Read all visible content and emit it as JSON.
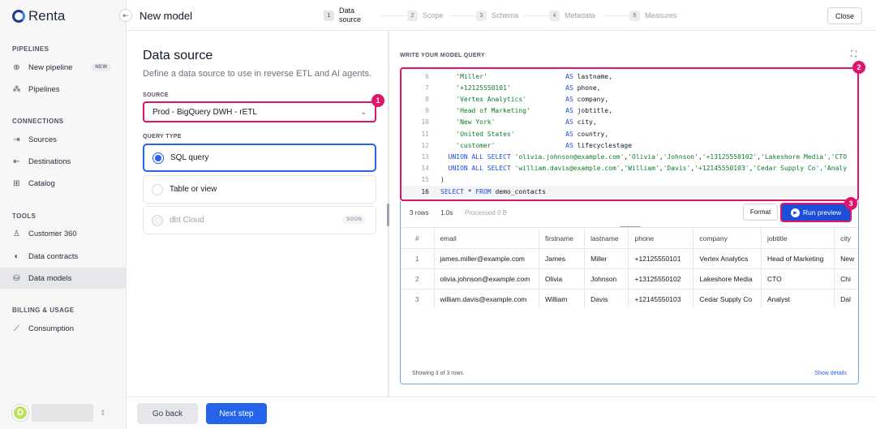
{
  "app": {
    "logo_text": "Renta"
  },
  "sidebar": {
    "sections": [
      {
        "label": "PIPELINES"
      },
      {
        "label": "CONNECTIONS"
      },
      {
        "label": "TOOLS"
      },
      {
        "label": "BILLING & USAGE"
      }
    ],
    "items": [
      {
        "label": "New pipeline",
        "badge": "NEW",
        "icon": "plus-circle-icon"
      },
      {
        "label": "Pipelines",
        "icon": "pipelines-icon"
      },
      {
        "label": "Sources",
        "icon": "sources-icon"
      },
      {
        "label": "Destinations",
        "icon": "destinations-icon"
      },
      {
        "label": "Catalog",
        "icon": "catalog-icon"
      },
      {
        "label": "Customer 360",
        "icon": "user-icon"
      },
      {
        "label": "Data contracts",
        "icon": "shield-icon"
      },
      {
        "label": "Data models",
        "icon": "database-icon",
        "active": true
      },
      {
        "label": "Consumption",
        "icon": "chart-icon"
      }
    ],
    "user": {
      "avatar_letter": "D"
    }
  },
  "header": {
    "title": "New model",
    "close_label": "Close",
    "steps": [
      {
        "num": "1",
        "label_line1": "Data",
        "label_line2": "source",
        "active": true
      },
      {
        "num": "2",
        "label": "Scope"
      },
      {
        "num": "3",
        "label": "Schema"
      },
      {
        "num": "4",
        "label": "Metadata"
      },
      {
        "num": "5",
        "label": "Measures"
      }
    ]
  },
  "left_panel": {
    "title": "Data source",
    "description": "Define a data source to use in reverse ETL and AI agents.",
    "source_label": "SOURCE",
    "source_value": "Prod - BigQuery DWH - rETL",
    "query_type_label": "QUERY TYPE",
    "query_types": [
      {
        "label": "SQL query",
        "selected": true
      },
      {
        "label": "Table or view",
        "selected": false
      },
      {
        "label": "dbt Cloud",
        "disabled": true,
        "badge": "SOON"
      }
    ]
  },
  "callouts": [
    "1",
    "2",
    "3"
  ],
  "editor": {
    "label": "WRITE YOUR MODEL QUERY",
    "lines": [
      {
        "n": "6",
        "parts": [
          {
            "t": "    ",
            "c": ""
          },
          {
            "t": "'Miller'",
            "c": "str"
          },
          {
            "t": "                    ",
            "c": ""
          },
          {
            "t": "AS",
            "c": "kw"
          },
          {
            "t": " lastname,",
            "c": ""
          }
        ]
      },
      {
        "n": "7",
        "parts": [
          {
            "t": "    ",
            "c": ""
          },
          {
            "t": "'+12125550101'",
            "c": "str"
          },
          {
            "t": "              ",
            "c": ""
          },
          {
            "t": "AS",
            "c": "kw"
          },
          {
            "t": " phone,",
            "c": ""
          }
        ]
      },
      {
        "n": "8",
        "parts": [
          {
            "t": "    ",
            "c": ""
          },
          {
            "t": "'Vertex Analytics'",
            "c": "str"
          },
          {
            "t": "          ",
            "c": ""
          },
          {
            "t": "AS",
            "c": "kw"
          },
          {
            "t": " company,",
            "c": ""
          }
        ]
      },
      {
        "n": "9",
        "parts": [
          {
            "t": "    ",
            "c": ""
          },
          {
            "t": "'Head of Marketing'",
            "c": "str"
          },
          {
            "t": "         ",
            "c": ""
          },
          {
            "t": "AS",
            "c": "kw"
          },
          {
            "t": " jobtitle,",
            "c": ""
          }
        ]
      },
      {
        "n": "10",
        "parts": [
          {
            "t": "    ",
            "c": ""
          },
          {
            "t": "'New York'",
            "c": "str"
          },
          {
            "t": "                  ",
            "c": ""
          },
          {
            "t": "AS",
            "c": "kw"
          },
          {
            "t": " city,",
            "c": ""
          }
        ]
      },
      {
        "n": "11",
        "parts": [
          {
            "t": "    ",
            "c": ""
          },
          {
            "t": "'United States'",
            "c": "str"
          },
          {
            "t": "             ",
            "c": ""
          },
          {
            "t": "AS",
            "c": "kw"
          },
          {
            "t": " country,",
            "c": ""
          }
        ]
      },
      {
        "n": "12",
        "parts": [
          {
            "t": "    ",
            "c": ""
          },
          {
            "t": "'customer'",
            "c": "str"
          },
          {
            "t": "                  ",
            "c": ""
          },
          {
            "t": "AS",
            "c": "kw"
          },
          {
            "t": " lifecyclestage",
            "c": ""
          }
        ]
      },
      {
        "n": "13",
        "parts": [
          {
            "t": "  ",
            "c": ""
          },
          {
            "t": "UNION ALL SELECT",
            "c": "kw"
          },
          {
            "t": " ",
            "c": ""
          },
          {
            "t": "'olivia.johnson@example.com'",
            "c": "str"
          },
          {
            "t": ",",
            "c": ""
          },
          {
            "t": "'Olivia'",
            "c": "str"
          },
          {
            "t": ",",
            "c": ""
          },
          {
            "t": "'Johnson'",
            "c": "str"
          },
          {
            "t": ",",
            "c": ""
          },
          {
            "t": "'+13125550102'",
            "c": "str"
          },
          {
            "t": ",",
            "c": ""
          },
          {
            "t": "'Lakeshore Media'",
            "c": "str"
          },
          {
            "t": ",'CTO",
            "c": "str"
          }
        ]
      },
      {
        "n": "14",
        "parts": [
          {
            "t": "  ",
            "c": ""
          },
          {
            "t": "UNION ALL SELECT",
            "c": "kw"
          },
          {
            "t": " ",
            "c": ""
          },
          {
            "t": "'william.davis@example.com'",
            "c": "str"
          },
          {
            "t": ",",
            "c": ""
          },
          {
            "t": "'William'",
            "c": "str"
          },
          {
            "t": ",",
            "c": ""
          },
          {
            "t": "'Davis'",
            "c": "str"
          },
          {
            "t": ",",
            "c": ""
          },
          {
            "t": "'+12145550103'",
            "c": "str"
          },
          {
            "t": ",",
            "c": ""
          },
          {
            "t": "'Cedar Supply Co'",
            "c": "str"
          },
          {
            "t": ",'Analy",
            "c": "str"
          }
        ]
      },
      {
        "n": "15",
        "parts": [
          {
            "t": ")",
            "c": ""
          }
        ]
      },
      {
        "n": "16",
        "current": true,
        "parts": [
          {
            "t": "SELECT",
            "c": "kw"
          },
          {
            "t": " * ",
            "c": ""
          },
          {
            "t": "FROM",
            "c": "kw"
          },
          {
            "t": " demo_contacts",
            "c": ""
          }
        ]
      }
    ]
  },
  "results": {
    "rows_count": "3 rows",
    "duration": "1.0s",
    "processed": "Processed 0 B",
    "format_label": "Format",
    "run_label": "Run preview",
    "columns": [
      "#",
      "email",
      "firstname",
      "lastname",
      "phone",
      "company",
      "jobtitle",
      "city"
    ],
    "rows": [
      [
        "1",
        "james.miller@example.com",
        "James",
        "Miller",
        "+12125550101",
        "Vertex Analytics",
        "Head of Marketing",
        "New"
      ],
      [
        "2",
        "olivia.johnson@example.com",
        "Olivia",
        "Johnson",
        "+13125550102",
        "Lakeshore Media",
        "CTO",
        "Chi"
      ],
      [
        "3",
        "william.davis@example.com",
        "William",
        "Davis",
        "+12145550103",
        "Cedar Supply Co",
        "Analyst",
        "Dal"
      ]
    ],
    "showing": "Showing 3 of 3 rows",
    "show_details": "Show details"
  },
  "footer": {
    "back_label": "Go back",
    "next_label": "Next step"
  }
}
